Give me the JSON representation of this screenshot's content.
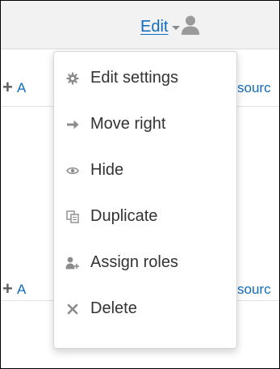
{
  "header": {
    "edit_label": "Edit"
  },
  "background_rows": [
    {
      "left_text": "A",
      "right_text": "sourc"
    },
    {
      "left_text": "A",
      "right_text": "sourc"
    }
  ],
  "menu": {
    "items": [
      {
        "label": "Edit settings",
        "icon": "gear-icon"
      },
      {
        "label": "Move right",
        "icon": "arrow-right-icon"
      },
      {
        "label": "Hide",
        "icon": "eye-icon"
      },
      {
        "label": "Duplicate",
        "icon": "duplicate-icon"
      },
      {
        "label": "Assign roles",
        "icon": "assign-roles-icon"
      },
      {
        "label": "Delete",
        "icon": "close-icon"
      }
    ]
  },
  "colors": {
    "link": "#0f6cbf",
    "icon": "#8c8c8c",
    "text": "#333333",
    "header_bg": "#f2f2f2"
  }
}
